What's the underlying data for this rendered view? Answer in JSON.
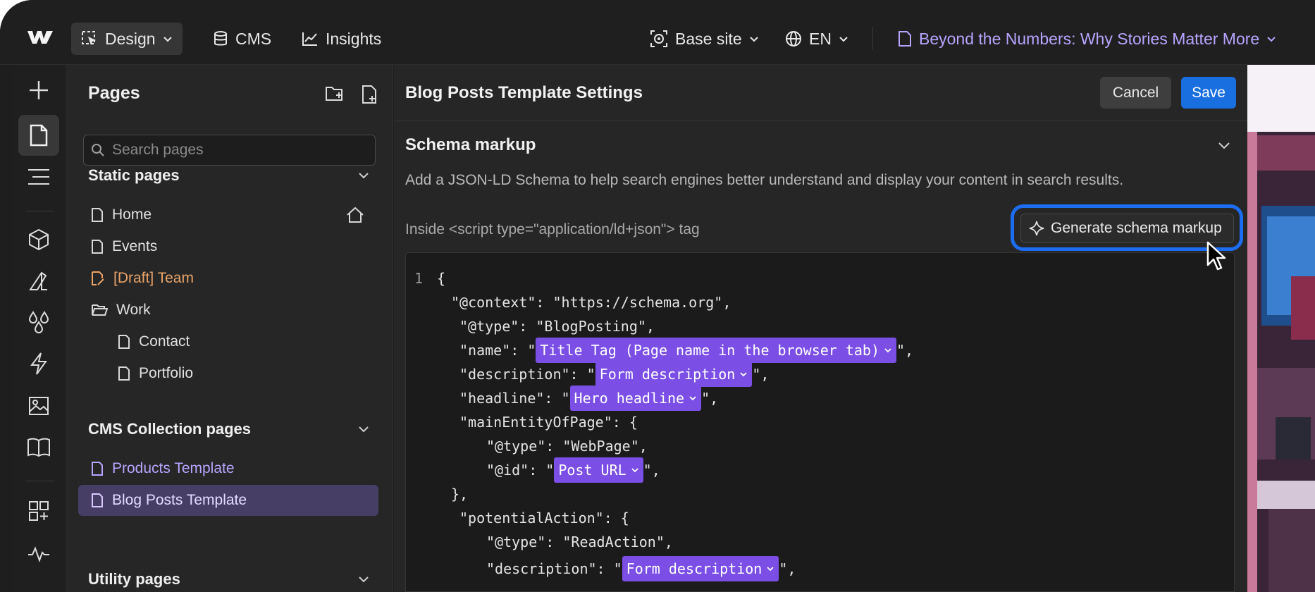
{
  "topbar": {
    "design_label": "Design",
    "cms_label": "CMS",
    "insights_label": "Insights",
    "site_label": "Base site",
    "locale_label": "EN",
    "page_label": "Beyond the Numbers: Why Stories Matter More"
  },
  "pages_panel": {
    "title": "Pages",
    "search_placeholder": "Search pages",
    "static_section": "Static pages",
    "static_pages": [
      "Home",
      "Events",
      "[Draft] Team",
      "Work",
      "Contact",
      "Portfolio"
    ],
    "cms_section": "CMS Collection pages",
    "cms_pages": [
      "Products Template",
      "Blog Posts Template"
    ],
    "utility_section": "Utility pages"
  },
  "settings": {
    "title": "Blog Posts Template Settings",
    "cancel_label": "Cancel",
    "save_label": "Save",
    "section_title": "Schema markup",
    "description": "Add a JSON-LD Schema to help search engines better understand and display your content in search results.",
    "script_label": "Inside <script type=\"application/ld+json\"> tag",
    "generate_label": "Generate schema markup"
  },
  "code": {
    "line_number": "1",
    "l1": "{",
    "l2": "\"@context\": \"https://schema.org\",",
    "l3": "\"@type\": \"BlogPosting\",",
    "l4_key": "\"name\": \"",
    "l4_chip": "Title Tag (Page name in the browser tab)",
    "l4_end": "\",",
    "l5_key": "\"description\": \"",
    "l5_chip": "Form description",
    "l5_end": "\",",
    "l6_key": "\"headline\": \"",
    "l6_chip": "Hero headline",
    "l6_end": "\",",
    "l7": "\"mainEntityOfPage\": {",
    "l8": "\"@type\": \"WebPage\",",
    "l9_key": "\"@id\": \"",
    "l9_chip": "Post URL",
    "l9_end": "\",",
    "l10": "},",
    "l11": "\"potentialAction\": {",
    "l12": "\"@type\": \"ReadAction\",",
    "l13_key": "\"description\": \"",
    "l13_chip": "Form description",
    "l13_end": "\","
  },
  "colors": {
    "accent_purple": "#7b4fe6",
    "save_blue": "#1a6fe0",
    "highlight_ring": "#1d6df1",
    "draft_orange": "#e9a36a",
    "cms_lavender": "#b8a4ff"
  },
  "icons": {
    "rail": [
      "plus-icon",
      "page-icon",
      "navigator-icon",
      "components-icon",
      "style-icon",
      "variables-icon",
      "interactions-icon",
      "assets-icon",
      "cms-book-icon",
      "apps-icon",
      "activity-icon"
    ]
  }
}
